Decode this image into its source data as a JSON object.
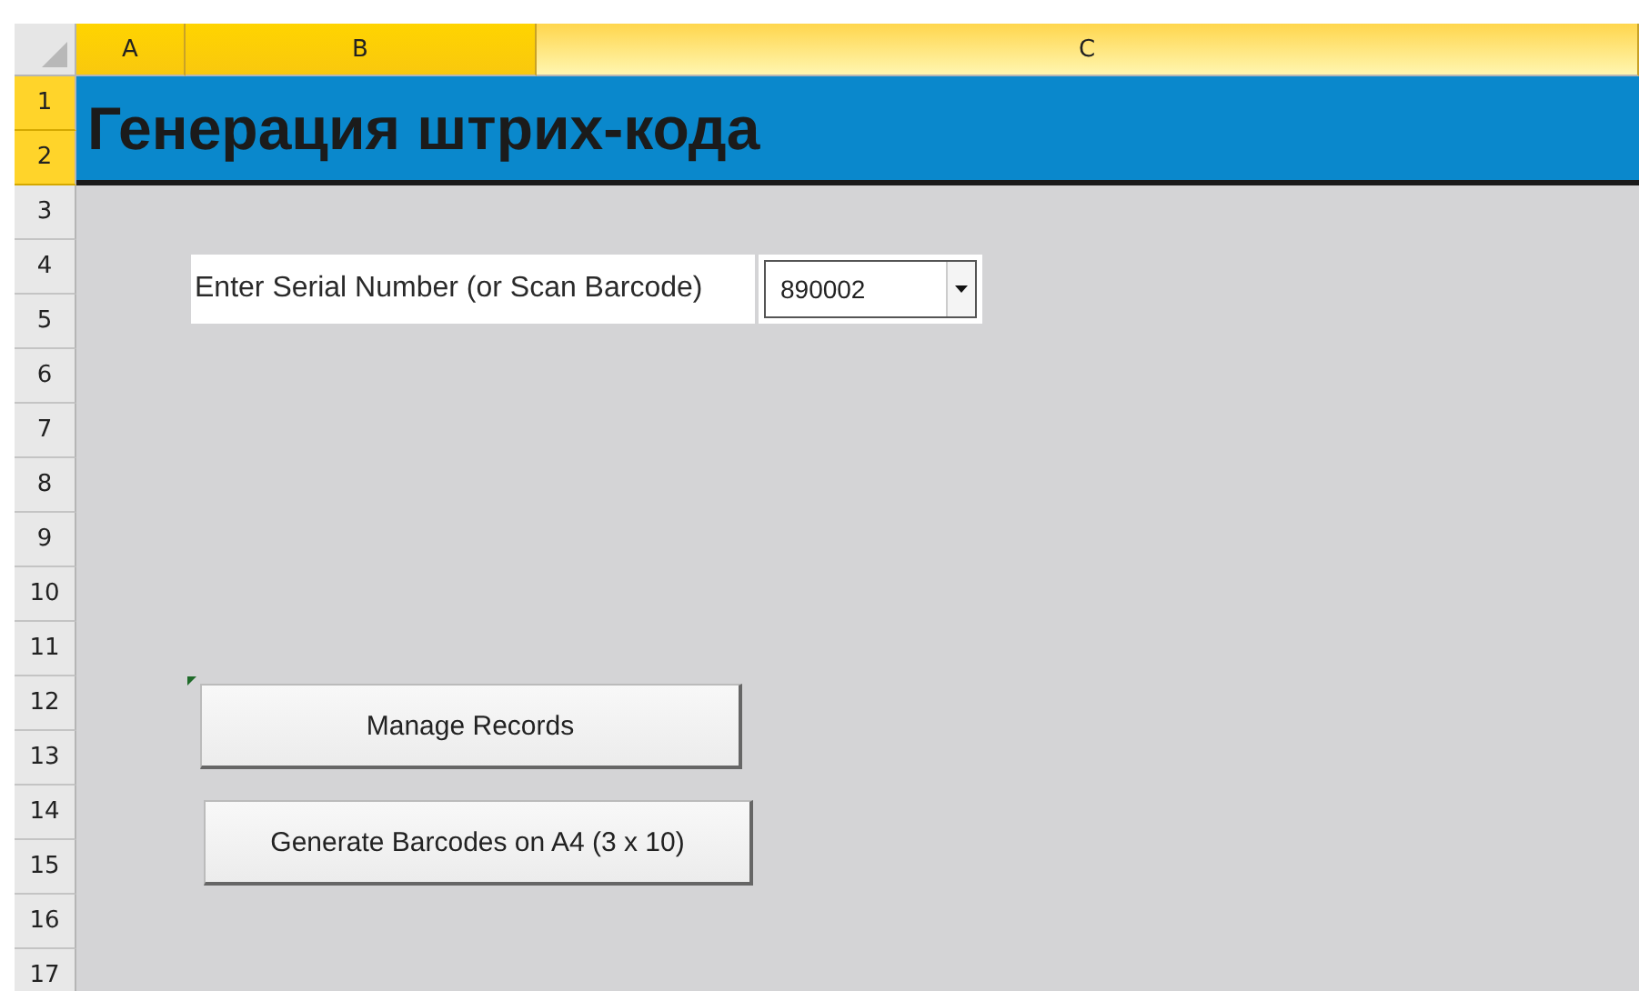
{
  "columns": [
    {
      "label": "A",
      "selected": true
    },
    {
      "label": "B",
      "selected": true
    },
    {
      "label": "C",
      "selected": true
    }
  ],
  "rows": [
    {
      "label": "1",
      "selected": true
    },
    {
      "label": "2",
      "selected": true
    },
    {
      "label": "3",
      "selected": false
    },
    {
      "label": "4",
      "selected": false
    },
    {
      "label": "5",
      "selected": false
    },
    {
      "label": "6",
      "selected": false
    },
    {
      "label": "7",
      "selected": false
    },
    {
      "label": "8",
      "selected": false
    },
    {
      "label": "9",
      "selected": false
    },
    {
      "label": "10",
      "selected": false
    },
    {
      "label": "11",
      "selected": false
    },
    {
      "label": "12",
      "selected": false
    },
    {
      "label": "13",
      "selected": false
    },
    {
      "label": "14",
      "selected": false
    },
    {
      "label": "15",
      "selected": false
    },
    {
      "label": "16",
      "selected": false
    },
    {
      "label": "17",
      "selected": false
    }
  ],
  "title": "Генерация штрих-кода",
  "serial": {
    "label": "Enter Serial Number (or Scan Barcode)",
    "value": "890002"
  },
  "buttons": [
    "Manage Records",
    "Generate Barcodes on A4 (3 x 10)"
  ]
}
